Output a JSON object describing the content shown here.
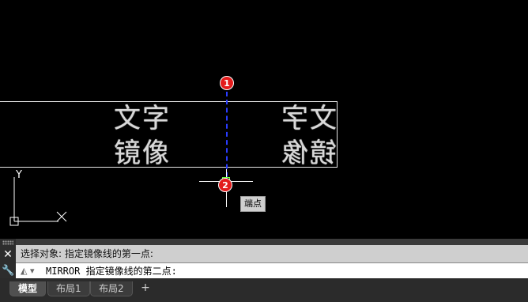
{
  "drawing": {
    "text_original": {
      "line1": "文字",
      "line2": "镜像"
    },
    "text_mirrored": {
      "line1": "文字",
      "line2": "镜像"
    },
    "markers": [
      "1",
      "2"
    ],
    "snap_tooltip": "端点",
    "ucs": {
      "y_axis": "Y"
    },
    "colors": {
      "mirror_line": "#2a3cff",
      "marker": "#e31b1b",
      "snap": "#6cff3a"
    }
  },
  "command": {
    "history": "选择对象:  指定镜像线的第一点:",
    "prompt": "MIRROR 指定镜像线的第二点:",
    "close_icon": "close-icon",
    "customize_icon": "wrench-icon"
  },
  "tabs": [
    {
      "label": "模型",
      "active": true
    },
    {
      "label": "布局1",
      "active": false
    },
    {
      "label": "布局2",
      "active": false
    }
  ],
  "add_tab_label": "+"
}
